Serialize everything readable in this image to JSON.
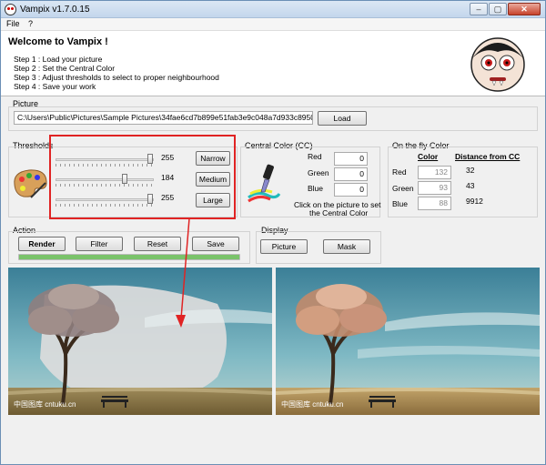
{
  "window": {
    "title": "Vampix v1.7.0.15",
    "min_label": "–",
    "max_label": "▢",
    "close_label": "✕"
  },
  "menu": [
    "File",
    "?"
  ],
  "welcome": {
    "title": "Welcome to Vampix !",
    "steps": [
      "Step 1 : Load your picture",
      "Step 2 : Set the Central Color",
      "Step 3 : Adjust thresholds to select to proper neighbourhood",
      "Step 4 : Save your work"
    ]
  },
  "picture": {
    "label": "Picture",
    "path": "C:\\Users\\Public\\Pictures\\Sample Pictures\\34fae6cd7b899e51fab3e9c048a7d933c8950d21.jp",
    "load_button": "Load"
  },
  "thresholds": {
    "label": "Thresholds",
    "sliders": [
      {
        "value": "255",
        "level": 1.0
      },
      {
        "value": "184",
        "level": 0.72
      },
      {
        "value": "255",
        "level": 1.0
      }
    ],
    "buttons": [
      "Narrow",
      "Medium",
      "Large"
    ]
  },
  "central_color": {
    "label": "Central Color (CC)",
    "channels": [
      {
        "name": "Red",
        "value": "0"
      },
      {
        "name": "Green",
        "value": "0"
      },
      {
        "name": "Blue",
        "value": "0"
      }
    ],
    "hint_line1": "Click on the picture to set",
    "hint_line2": "the Central Color"
  },
  "on_the_fly": {
    "label": "On the fly Color",
    "color_header": "Color",
    "distance_header": "Distance from CC",
    "rows": [
      {
        "name": "Red",
        "value": "132",
        "distance": "32"
      },
      {
        "name": "Green",
        "value": "93",
        "distance": "43"
      },
      {
        "name": "Blue",
        "value": "88",
        "distance": "9912"
      }
    ]
  },
  "action": {
    "label": "Action",
    "buttons": [
      "Render",
      "Filter",
      "Reset",
      "Save"
    ],
    "progress": 1.0
  },
  "display": {
    "label": "Display",
    "buttons": [
      "Picture",
      "Mask"
    ]
  },
  "images": {
    "watermark": "中国图库 cntuku.cn"
  },
  "colors": {
    "accent_red": "#e02323",
    "progress_green": "#7ac36a",
    "title_bar": "#c3d6ec"
  }
}
